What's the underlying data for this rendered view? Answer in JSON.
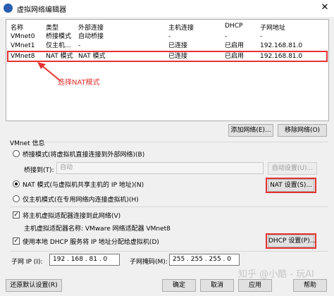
{
  "window": {
    "title": "虚拟网络编辑器",
    "close_glyph": "✕"
  },
  "table": {
    "headers": [
      "名称",
      "类型",
      "外部连接",
      "主机连接",
      "DHCP",
      "子网地址"
    ],
    "rows": [
      [
        "VMnet0",
        "桥接模式",
        "自动桥接",
        "-",
        "-",
        "-"
      ],
      [
        "VMnet1",
        "仅主机...",
        "-",
        "已连接",
        "已启用",
        "192.168.81.0"
      ],
      [
        "VMnet8",
        "NAT 模式",
        "NAT 模式",
        "已连接",
        "已启用",
        "192.168.81.0"
      ]
    ]
  },
  "annotation": {
    "text": "选择NAT模式",
    "color": "#e53333"
  },
  "buttons": {
    "add_network": "添加网络(E)...",
    "remove_network": "移除网络(O)"
  },
  "vmnet_info": {
    "title": "VMnet 信息",
    "bridge_mode": "桥接模式(将虚拟机直接连接到外部网络)(B)",
    "bridge_to_label": "桥接到(T):",
    "bridge_to_value": "自动",
    "auto_settings": "自动设置(U)...",
    "nat_mode": "NAT 模式(与虚拟机共享主机的 IP 地址)(N)",
    "nat_settings": "NAT 设置(S)...",
    "host_only_mode": "仅主机模式(在专用网络内连接虚拟机)(H)",
    "connect_adapter": "将主机虚拟适配器连接到此网络(V)",
    "adapter_name": "主机虚拟适配器名称: VMware 网络适配器 VMnet8",
    "use_dhcp": "使用本地 DHCP 服务将 IP 地址分配给虚拟机(D)",
    "dhcp_settings": "DHCP 设置(P)...",
    "subnet_ip_label": "子网 IP (I):",
    "subnet_ip_value": "192 . 168 . 81 . 0",
    "subnet_mask_label": "子网掩码(M):",
    "subnet_mask_value": "255 . 255 . 255 . 0",
    "check_glyph": "✓"
  },
  "footer": {
    "restore_defaults": "还原默认设置(R)",
    "ok": "确定",
    "cancel": "取消",
    "apply": "应用",
    "help": "帮助"
  },
  "watermark": "知乎 @小酷 - 玩AI"
}
